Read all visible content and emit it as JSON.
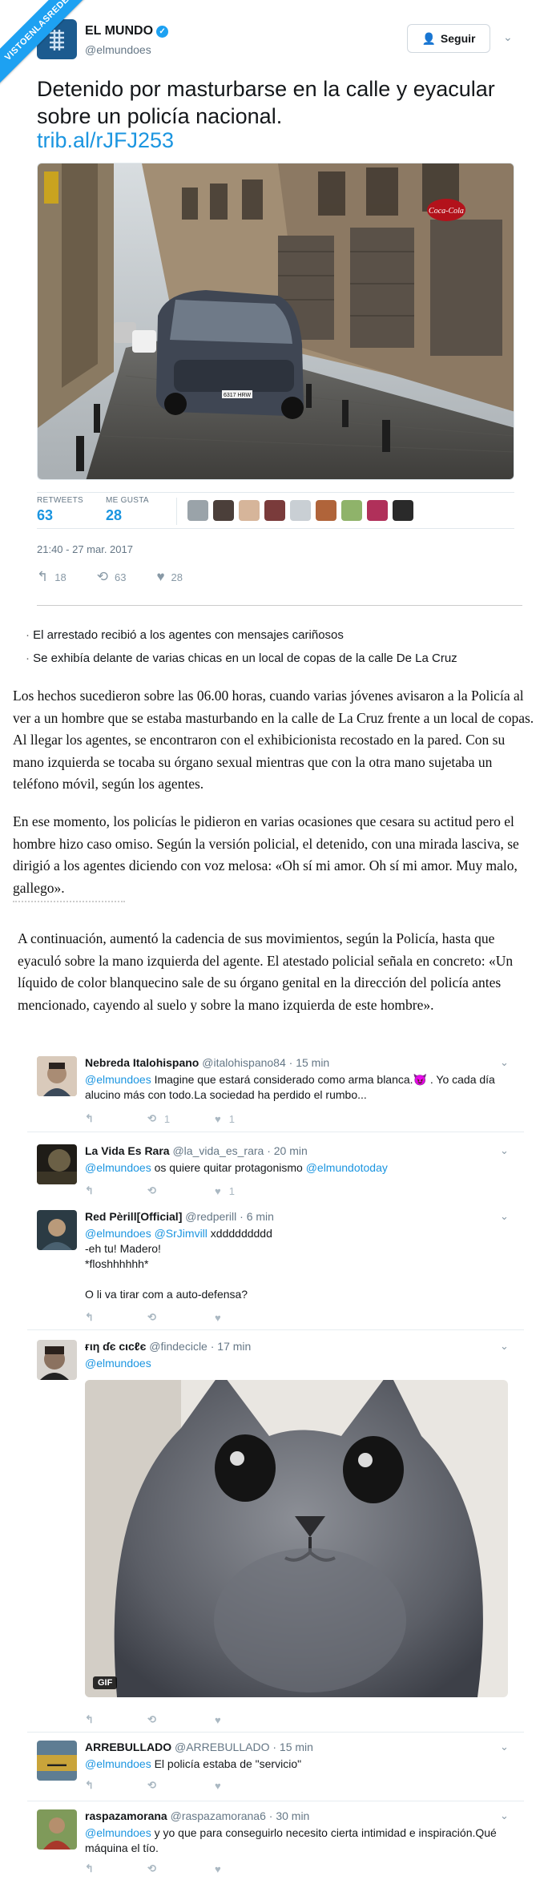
{
  "watermark": "VISTOENLASREDES",
  "tweet": {
    "name": "EL MUNDO",
    "handle": "@elmundoes",
    "follow_label": "Seguir",
    "text": "Detenido por masturbarse en la calle y eyacular sobre un policía nacional.",
    "link": "trib.al/rJFJ253",
    "photo": {
      "sign": "Coca-Cola",
      "plate": "6317 HRW"
    },
    "retweets_label": "RETWEETS",
    "retweets": "63",
    "likes_label": "ME GUSTA",
    "likes": "28",
    "time": "21:40 - 27 mar. 2017",
    "actions": {
      "reply": "18",
      "retweet": "63",
      "like": "28"
    }
  },
  "article": {
    "bullets": [
      "El arrestado recibió a los agentes con mensajes cariñosos",
      "Se exhibía delante de varias chicas en un local de copas de la calle De La Cruz"
    ],
    "p1": "Los hechos sucedieron sobre las 06.00 horas, cuando varias jóvenes avisaron a la Policía al ver a un hombre que se estaba masturbando en la calle de La Cruz frente a un local de copas. Al llegar los agentes, se encontraron con el exhibicionista recostado en la pared. Con su mano izquierda se tocaba su órgano sexual mientras que con la otra mano sujetaba un teléfono móvil, según los agentes.",
    "p2": "En ese momento, los policías le pidieron en varias ocasiones que cesara su actitud pero el hombre hizo caso omiso. Según la versión policial, el detenido, con una mirada lasciva, se dirigió a los agentes diciendo con voz melosa: «Oh sí mi amor. Oh sí mi amor. Muy malo, gallego».",
    "p3": "A continuación, aumentó la cadencia de sus movimientos, según la Policía, hasta que eyaculó sobre la mano izquierda del agente. El atestado policial señala en concreto: «Un líquido de color blanquecino sale de su órgano genital en la dirección del policía antes mencionado, cayendo al suelo y sobre la mano izquierda de este hombre»."
  },
  "replies": [
    {
      "name": "Nebreda Italohispano",
      "meta": "@italohispano84 · 15 min",
      "mention": "@elmundoes",
      "text": " Imagine que estará considerado como arma blanca.😈 . Yo cada día alucino más con todo.La sociedad ha perdido el rumbo...",
      "retweets": "1",
      "likes": "1"
    },
    {
      "name": "La Vida Es Rara",
      "meta": "@la_vida_es_rara · 20 min",
      "mention": "@elmundoes",
      "text": " os quiere quitar protagonismo ",
      "mention2": "@elmundotoday",
      "retweets": "",
      "likes": "1"
    },
    {
      "name": "Red Pèrill[Official]",
      "meta": "@redperill · 6 min",
      "mention": "@elmundoes @SrJimvill",
      "text": " xddddddddd\n-eh tu! Madero!\n*floshhhhhh*\n\nO li va tirar com a auto-defensa?",
      "retweets": "",
      "likes": ""
    },
    {
      "name": "ғιη ɗє cιcℓє",
      "meta": "@findecicle · 17 min",
      "mention": "@elmundoes",
      "text": "",
      "gif_label": "GIF",
      "retweets": "",
      "likes": ""
    },
    {
      "name": "ARREBULLADO",
      "meta": "@ARREBULLADO · 15 min",
      "mention": "@elmundoes",
      "text": " El policía estaba de \"servicio\"",
      "retweets": "",
      "likes": ""
    },
    {
      "name": "raspazamorana",
      "meta": "@raspazamorana6 · 30 min",
      "mention": "@elmundoes",
      "text": " y yo que para conseguirlo necesito cierta intimidad e inspiración.Qué máquina el tío.",
      "retweets": "",
      "likes": ""
    }
  ],
  "icons": {
    "reply": "↰",
    "retweet": "⟲",
    "like": "♥",
    "chevron": "⌄",
    "follow": "+"
  },
  "colors": {
    "accent": "#1da1f2",
    "link": "#1b95e0",
    "muted": "#657786",
    "icon": "#aab8c2"
  }
}
